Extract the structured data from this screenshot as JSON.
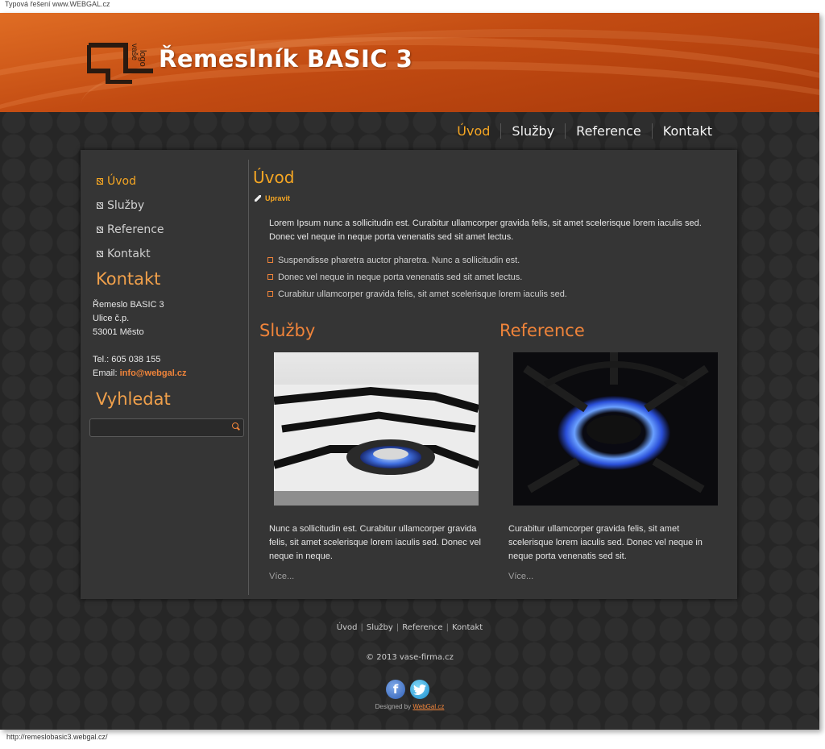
{
  "top_note": "Typová řešení www.WEBGAL.cz",
  "status_url": "http://remeslobasic3.webgal.cz/",
  "header": {
    "title": "Řemeslník BASIC 3",
    "logo_text": "vaše logo"
  },
  "topnav": [
    "Úvod",
    "Služby",
    "Reference",
    "Kontakt"
  ],
  "sidebar": {
    "menu": [
      "Úvod",
      "Služby",
      "Reference",
      "Kontakt"
    ],
    "contact_heading": "Kontakt",
    "address": [
      "Řemeslo BASIC 3",
      "Ulice č.p.",
      "53001 Město"
    ],
    "phone": "Tel.: 605 038 155",
    "email_label": "Email:",
    "email": "info@webgal.cz",
    "search_heading": "Vyhledat",
    "search_placeholder": ""
  },
  "main": {
    "heading": "Úvod",
    "edit_label": "Upravit",
    "lead": "Lorem Ipsum nunc a sollicitudin est. Curabitur ullamcorper gravida felis, sit amet scelerisque lorem iaculis sed. Donec vel neque in neque porta venenatis sed sit amet lectus.",
    "bullets": [
      "Suspendisse pharetra auctor pharetra. Nunc a sollicitudin est.",
      "Donec vel neque in neque porta venenatis sed sit amet lectus.",
      "Curabitur ullamcorper gravida felis, sit amet scelerisque lorem iaculis sed."
    ],
    "columns": [
      {
        "heading": "Služby",
        "text": "Nunc a sollicitudin est. Curabitur ullamcorper gravida felis, sit amet scelerisque lorem iaculis sed. Donec vel neque in neque.",
        "more": "Více..."
      },
      {
        "heading": "Reference",
        "text": "Curabitur ullamcorper gravida felis, sit amet scelerisque lorem iaculis sed. Donec vel neque in neque porta venenatis sed sit.",
        "more": "Více..."
      }
    ]
  },
  "footer": {
    "nav": [
      "Úvod",
      "Služby",
      "Reference",
      "Kontakt"
    ],
    "copyright": "© 2013 vase-firma.cz",
    "designed_by_prefix": "Designed by",
    "designed_by_link": "WebGal.cz",
    "social": [
      "facebook-icon",
      "twitter-icon"
    ]
  },
  "colors": {
    "accent": "#f5a623",
    "accent_orange": "#f0843a",
    "header_orange": "#c24b12",
    "background": "#262626",
    "panel": "#353535"
  }
}
